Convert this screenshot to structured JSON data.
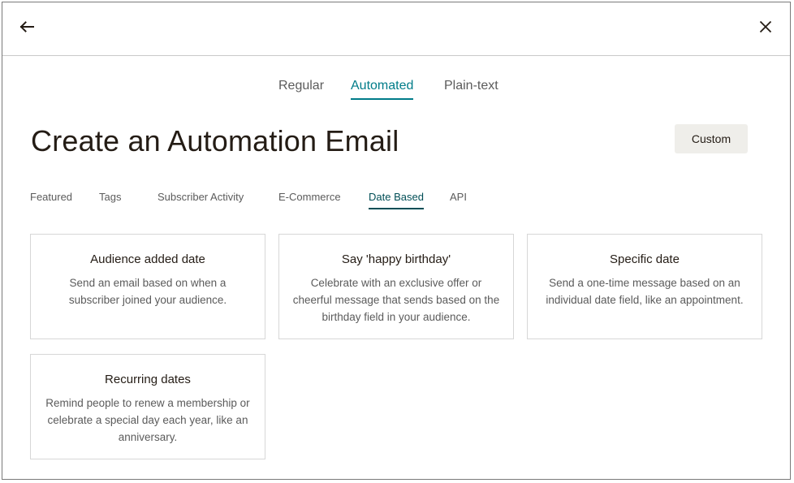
{
  "header": {
    "back_icon": "arrow-left-icon",
    "close_icon": "close-icon"
  },
  "email_types": [
    {
      "label": "Regular",
      "active": false
    },
    {
      "label": "Automated",
      "active": true
    },
    {
      "label": "Plain-text",
      "active": false
    }
  ],
  "page": {
    "title": "Create an Automation Email",
    "custom_label": "Custom"
  },
  "categories": [
    {
      "label": "Featured",
      "active": false
    },
    {
      "label": "Tags",
      "active": false
    },
    {
      "label": "Subscriber Activity",
      "active": false
    },
    {
      "label": "E-Commerce",
      "active": false
    },
    {
      "label": "Date Based",
      "active": true
    },
    {
      "label": "API",
      "active": false
    }
  ],
  "cards": [
    {
      "title": "Audience added date",
      "description": "Send an email based on when a subscriber joined your audience."
    },
    {
      "title": "Say 'happy birthday'",
      "description": "Celebrate with an exclusive offer or cheerful message that sends based on the birthday field in your audience."
    },
    {
      "title": "Specific date",
      "description": "Send a one-time message based on an individual date field, like an appointment."
    },
    {
      "title": "Recurring dates",
      "description": "Remind people to renew a membership or celebrate a special day each year, like an anniversary."
    }
  ],
  "colors": {
    "accent": "#007c89",
    "active_category": "#004e56",
    "text": "#241c15",
    "muted": "#5b5b5b"
  }
}
